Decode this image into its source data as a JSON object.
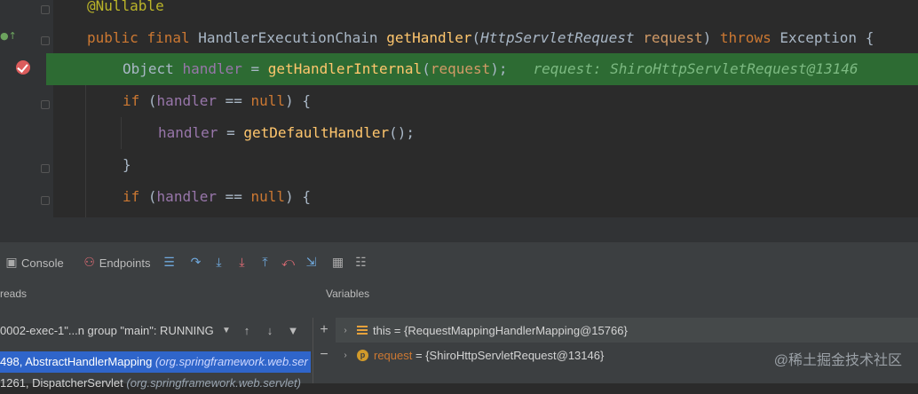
{
  "editor": {
    "lines": [
      {
        "annotation": "@Nullable"
      },
      {
        "kw_public": "public",
        "kw_final": "final",
        "return_type": "HandlerExecutionChain",
        "method": "getHandler",
        "open_paren": "(",
        "param_type": "HttpServletRequest",
        "param_name": "request",
        "close_paren": ")",
        "kw_throws": "throws",
        "exception": "Exception",
        "brace": "{"
      },
      {
        "type": "Object",
        "var": "handler",
        "eq": "=",
        "call": "getHandlerInternal",
        "open": "(",
        "arg": "request",
        "close": ");",
        "inline_value": "request: ShiroHttpServletRequest@13146"
      },
      {
        "kw_if": "if",
        "cond_open": "(",
        "var": "handler",
        "op": "==",
        "kw_null": "null",
        "cond_close": ")",
        "brace": "{"
      },
      {
        "var": "handler",
        "eq": "=",
        "call": "getDefaultHandler",
        "tail": "();"
      },
      {
        "brace": "}"
      },
      {
        "kw_if": "if",
        "cond_open": "(",
        "var": "handler",
        "op": "==",
        "kw_null": "null",
        "cond_close": ")",
        "brace": "{"
      }
    ]
  },
  "toolbar": {
    "console_label": "Console",
    "endpoints_label": "Endpoints"
  },
  "threads": {
    "header": "reads",
    "selected_thread": "0002-exec-1\"...n group \"main\": RUNNING",
    "frames": [
      {
        "line": "498",
        "method": "AbstractHandlerMapping",
        "pkg": "(org.springframework.web.ser"
      },
      {
        "line": "1261",
        "method": "DispatcherServlet",
        "pkg": "(org.springframework.web.servlet)"
      }
    ]
  },
  "variables": {
    "header": "Variables",
    "rows": [
      {
        "name": "this",
        "eq": "=",
        "value": "{RequestMappingHandlerMapping@15766}"
      },
      {
        "name": "request",
        "eq": "=",
        "value": "{ShiroHttpServletRequest@13146}"
      }
    ]
  },
  "watermark": "@稀土掘金技术社区",
  "icons": {
    "breakpoint": "breakpoint-check-icon",
    "override": "override-marker-icon"
  },
  "colors": {
    "highlight_line": "#2d6b33",
    "selected_frame": "#2f65ca",
    "keyword": "#cc7832",
    "method": "#ffc66d"
  }
}
